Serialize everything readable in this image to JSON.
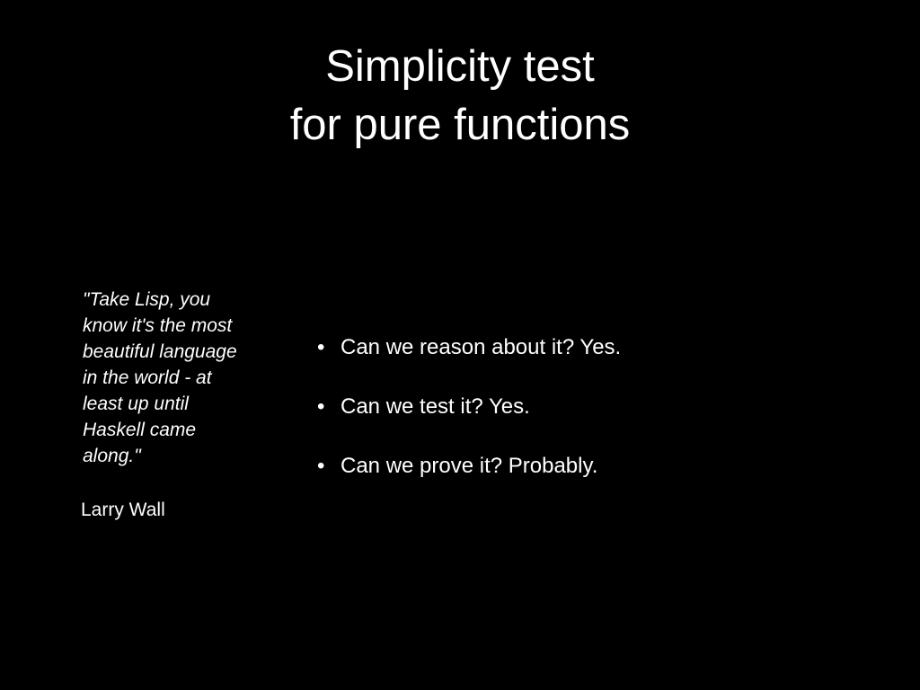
{
  "slide": {
    "title_lines": [
      "Simplicity test",
      "for pure functions"
    ],
    "quote": {
      "lines": [
        "\"Take Lisp, you",
        "know it's the most",
        "beautiful language",
        "in the world - at",
        "least up until",
        "Haskell came",
        "along.\""
      ],
      "author": "Larry Wall"
    },
    "bullet_glyph": "•",
    "bullets": [
      "Can we reason about it? Yes.",
      "Can we test it? Yes.",
      "Can we prove it? Probably."
    ],
    "colors": {
      "background": "#000000",
      "text": "#ffffff"
    }
  }
}
